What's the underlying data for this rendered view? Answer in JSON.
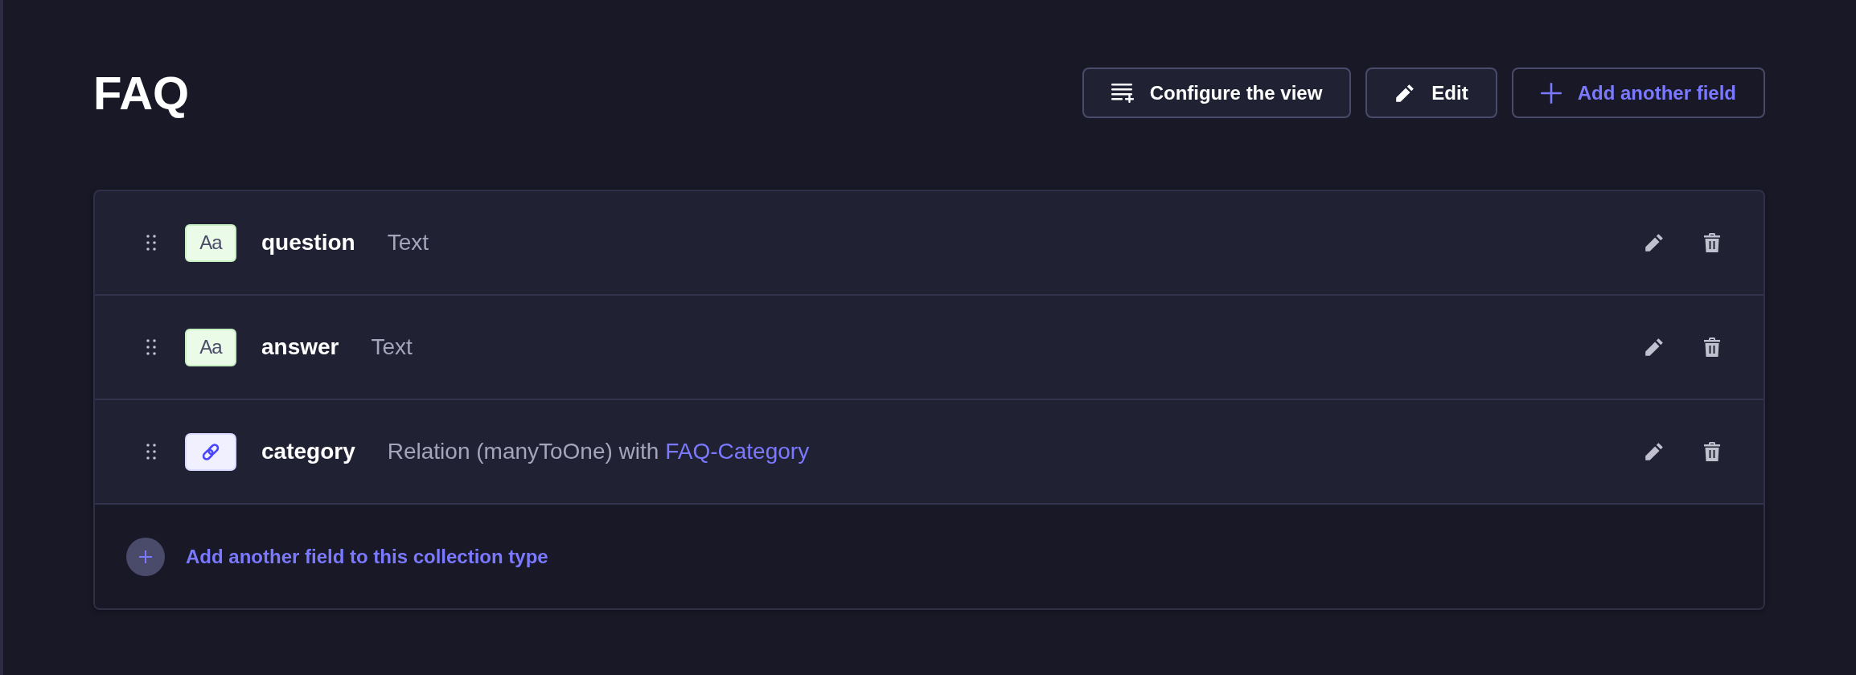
{
  "page": {
    "title": "FAQ"
  },
  "actions": [
    {
      "kind": "configure",
      "label": "Configure the view"
    },
    {
      "kind": "edit",
      "label": "Edit"
    },
    {
      "kind": "add",
      "label": "Add another field"
    }
  ],
  "fields": [
    {
      "name": "question",
      "kind": "text",
      "icon_text": "Aa",
      "type": "Text"
    },
    {
      "name": "answer",
      "kind": "text",
      "icon_text": "Aa",
      "type": "Text"
    },
    {
      "name": "category",
      "kind": "relation",
      "type": "Relation (manyToOne) with",
      "target": "FAQ-Category"
    }
  ],
  "footer": {
    "label": "Add another field to this collection type"
  }
}
